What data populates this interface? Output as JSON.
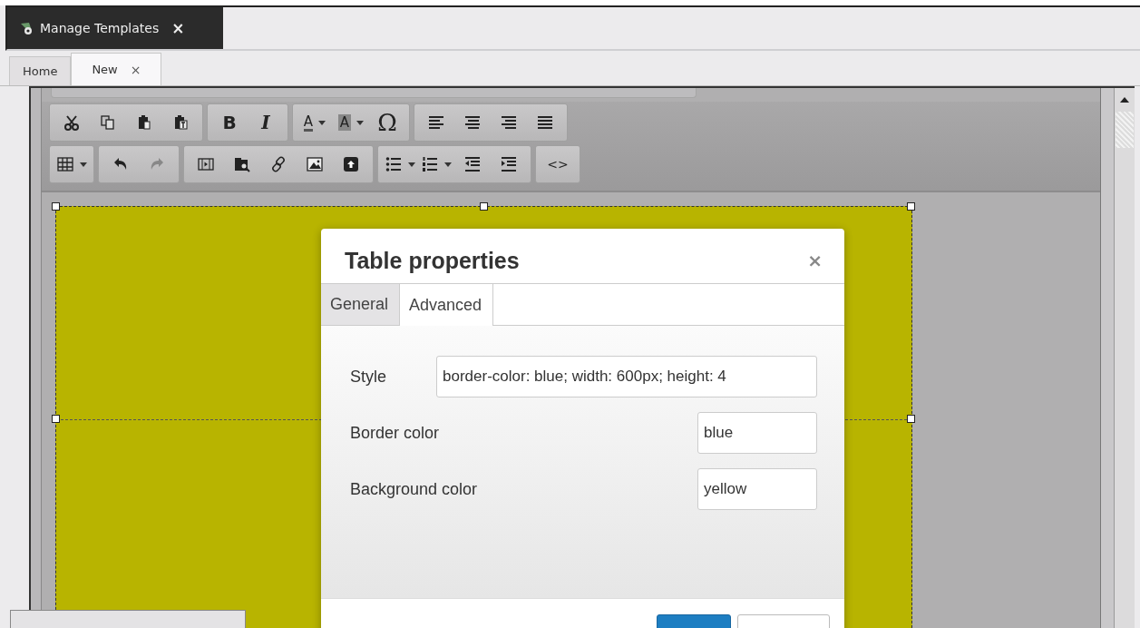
{
  "app_tab": {
    "title": "Manage Templates",
    "close": "×"
  },
  "doc_tabs": [
    {
      "label": "Home",
      "selected": false
    },
    {
      "label": "New",
      "selected": true,
      "close": "×"
    }
  ],
  "toolbar": {
    "rows": [
      [
        [
          {
            "kind": "cut"
          },
          {
            "kind": "copy"
          },
          {
            "kind": "paste"
          },
          {
            "kind": "pastetext"
          }
        ],
        [
          {
            "kind": "bold",
            "text": "B"
          },
          {
            "kind": "italic",
            "text": "I"
          }
        ],
        [
          {
            "kind": "forecolor",
            "text": "A",
            "dropdown": true
          },
          {
            "kind": "backcolor",
            "text": "A",
            "dropdown": true
          },
          {
            "kind": "charmap",
            "text": "Ω"
          }
        ],
        [
          {
            "kind": "alignleft"
          },
          {
            "kind": "aligncenter"
          },
          {
            "kind": "alignright"
          },
          {
            "kind": "justify"
          }
        ]
      ],
      [
        [
          {
            "kind": "table",
            "dropdown": true
          }
        ],
        [
          {
            "kind": "undo"
          },
          {
            "kind": "redo",
            "disabled": true
          }
        ],
        [
          {
            "kind": "media"
          },
          {
            "kind": "preview"
          },
          {
            "kind": "link"
          },
          {
            "kind": "image"
          },
          {
            "kind": "upload"
          }
        ],
        [
          {
            "kind": "bullets",
            "dropdown": true
          },
          {
            "kind": "numbers",
            "dropdown": true
          },
          {
            "kind": "outdent"
          },
          {
            "kind": "indent"
          }
        ],
        [
          {
            "kind": "code",
            "text": "<>"
          }
        ]
      ]
    ]
  },
  "dialog": {
    "title": "Table properties",
    "close": "×",
    "tabs": [
      {
        "label": "General",
        "selected": false
      },
      {
        "label": "Advanced",
        "selected": true
      }
    ],
    "fields": [
      {
        "kind": "wide",
        "label": "Style",
        "value": "border-color: blue; width: 600px; height: 4"
      },
      {
        "kind": "short",
        "label": "Border color",
        "value": "blue"
      },
      {
        "kind": "short",
        "label": "Background color",
        "value": "yellow"
      }
    ],
    "buttons": [
      {
        "kind": "primary"
      },
      {
        "kind": "default"
      }
    ]
  }
}
